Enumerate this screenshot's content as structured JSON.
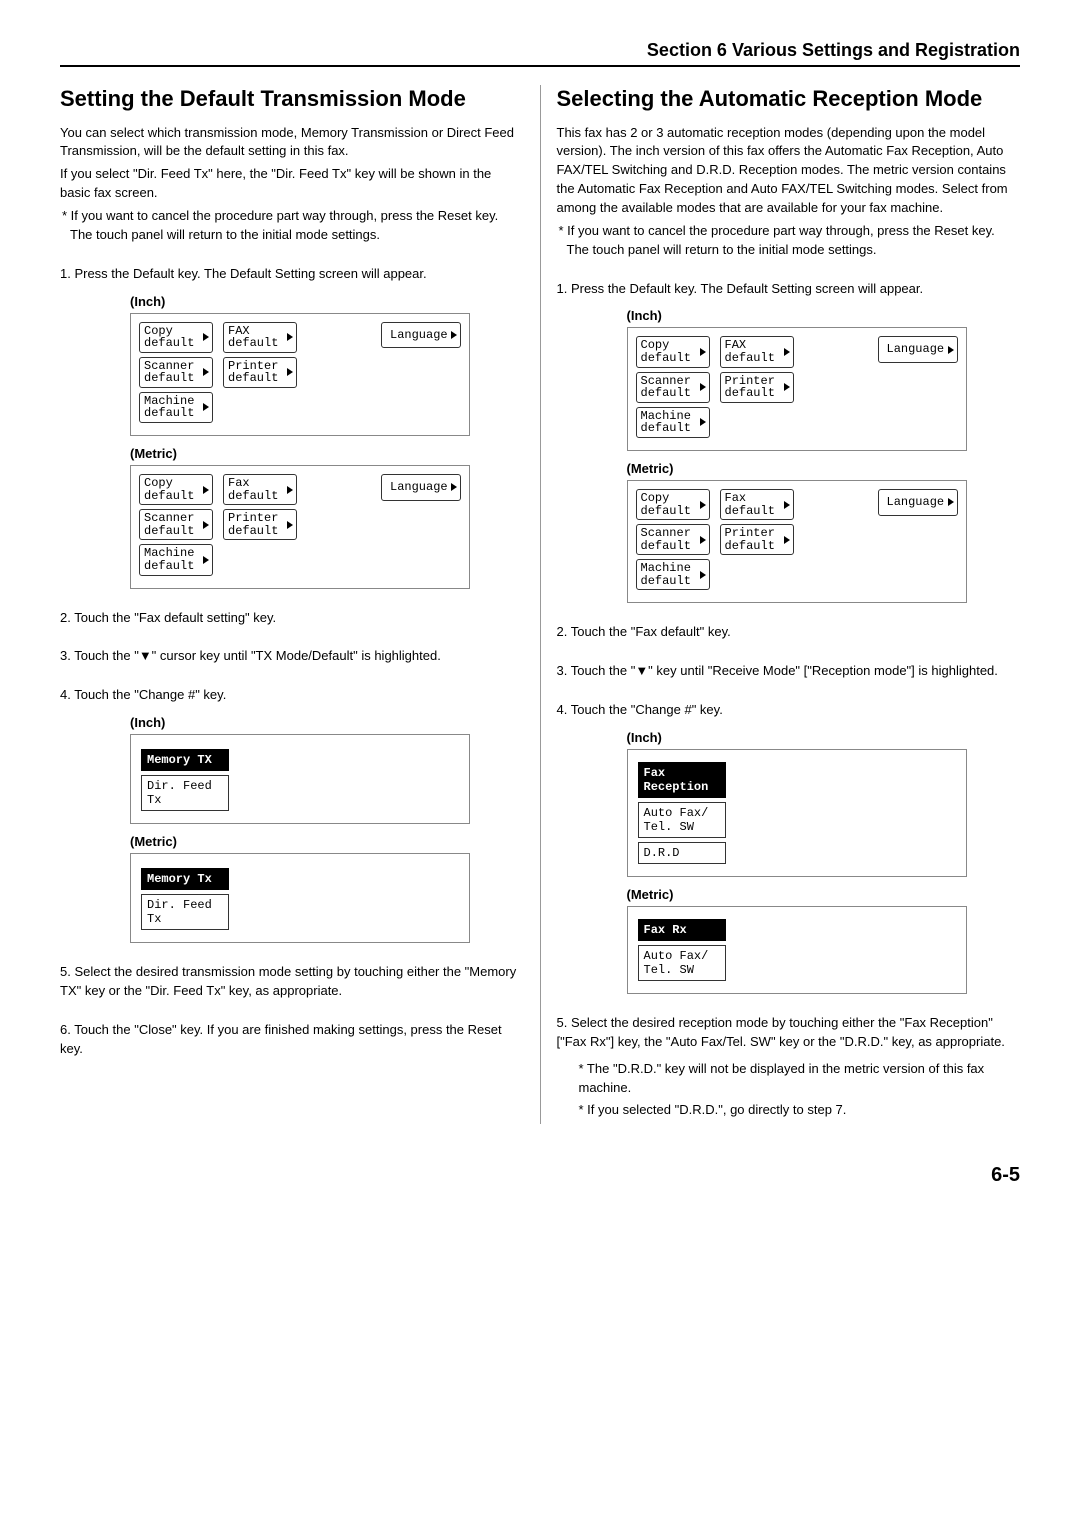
{
  "header": {
    "section": "Section 6  Various Settings and Registration"
  },
  "left": {
    "title": "Setting the Default Transmission Mode",
    "intro1": "You can select which transmission mode, Memory Transmission or Direct Feed Transmission, will be the default setting in this fax.",
    "intro2": "If you select \"Dir. Feed Tx\" here, the \"Dir. Feed Tx\" key will be shown in the basic fax screen.",
    "note": "* If you want to cancel the procedure part way through, press the Reset key. The touch panel will return to the initial mode settings.",
    "step1": "1. Press the Default key. The Default Setting screen will appear.",
    "label_inch": "(Inch)",
    "label_metric": "(Metric)",
    "panel_inch": {
      "copy": "Copy\ndefault",
      "fax": "FAX\ndefault",
      "lang": "Language",
      "scanner": "Scanner\ndefault",
      "printer": "Printer\ndefault",
      "machine": "Machine\ndefault"
    },
    "panel_metric": {
      "copy": "Copy\ndefault",
      "fax": "Fax\ndefault",
      "lang": "Language",
      "scanner": "Scanner\ndefault",
      "printer": "Printer\ndefault",
      "machine": "Machine\ndefault"
    },
    "step2": "2. Touch the \"Fax default setting\" key.",
    "step3": "3. Touch the \"▼\" cursor key until \"TX Mode/Default\" is highlighted.",
    "step4": "4. Touch the \"Change #\" key.",
    "tx_inch": {
      "memory": "Memory TX",
      "dir": "Dir. Feed\nTx"
    },
    "tx_metric": {
      "memory": "Memory Tx",
      "dir": "Dir. Feed\nTx"
    },
    "step5": "5. Select the desired transmission mode setting by touching either the \"Memory TX\" key or the \"Dir. Feed Tx\" key, as appropriate.",
    "step6": "6. Touch the \"Close\" key. If you are finished making settings, press the Reset key."
  },
  "right": {
    "title": "Selecting the Automatic Reception Mode",
    "intro": "This fax has 2 or 3 automatic reception modes (depending upon the model version). The inch version of this fax offers the Automatic Fax Reception, Auto FAX/TEL Switching and D.R.D. Reception modes. The metric version contains the Automatic Fax Reception and Auto FAX/TEL Switching modes. Select from among the available modes that are available for your fax machine.",
    "note": "* If you want to cancel the procedure part way through, press the Reset key. The touch panel will return to the initial mode settings.",
    "step1": "1. Press the Default key. The Default Setting screen will appear.",
    "label_inch": "(Inch)",
    "label_metric": "(Metric)",
    "panel_inch": {
      "copy": "Copy\ndefault",
      "fax": "FAX\ndefault",
      "lang": "Language",
      "scanner": "Scanner\ndefault",
      "printer": "Printer\ndefault",
      "machine": "Machine\ndefault"
    },
    "panel_metric": {
      "copy": "Copy\ndefault",
      "fax": "Fax\ndefault",
      "lang": "Language",
      "scanner": "Scanner\ndefault",
      "printer": "Printer\ndefault",
      "machine": "Machine\ndefault"
    },
    "step2": "2. Touch the \"Fax default\" key.",
    "step3": "3. Touch the \"▼\" key until \"Receive Mode\" [\"Reception mode\"] is highlighted.",
    "step4": "4. Touch the \"Change #\" key.",
    "rx_inch": {
      "fax": "Fax\nReception",
      "auto": "Auto Fax/\nTel. SW",
      "drd": "D.R.D"
    },
    "rx_metric": {
      "fax": "Fax Rx",
      "auto": "Auto Fax/\nTel. SW"
    },
    "step5": "5. Select the desired reception mode by touching either the \"Fax Reception\" [\"Fax Rx\"] key, the \"Auto Fax/Tel. SW\" key or the \"D.R.D.\" key, as appropriate.",
    "step5n1": "* The \"D.R.D.\" key will not be displayed in the metric version of this fax machine.",
    "step5n2": "* If you selected \"D.R.D.\", go directly to step 7."
  },
  "footer": {
    "page": "6-5"
  }
}
